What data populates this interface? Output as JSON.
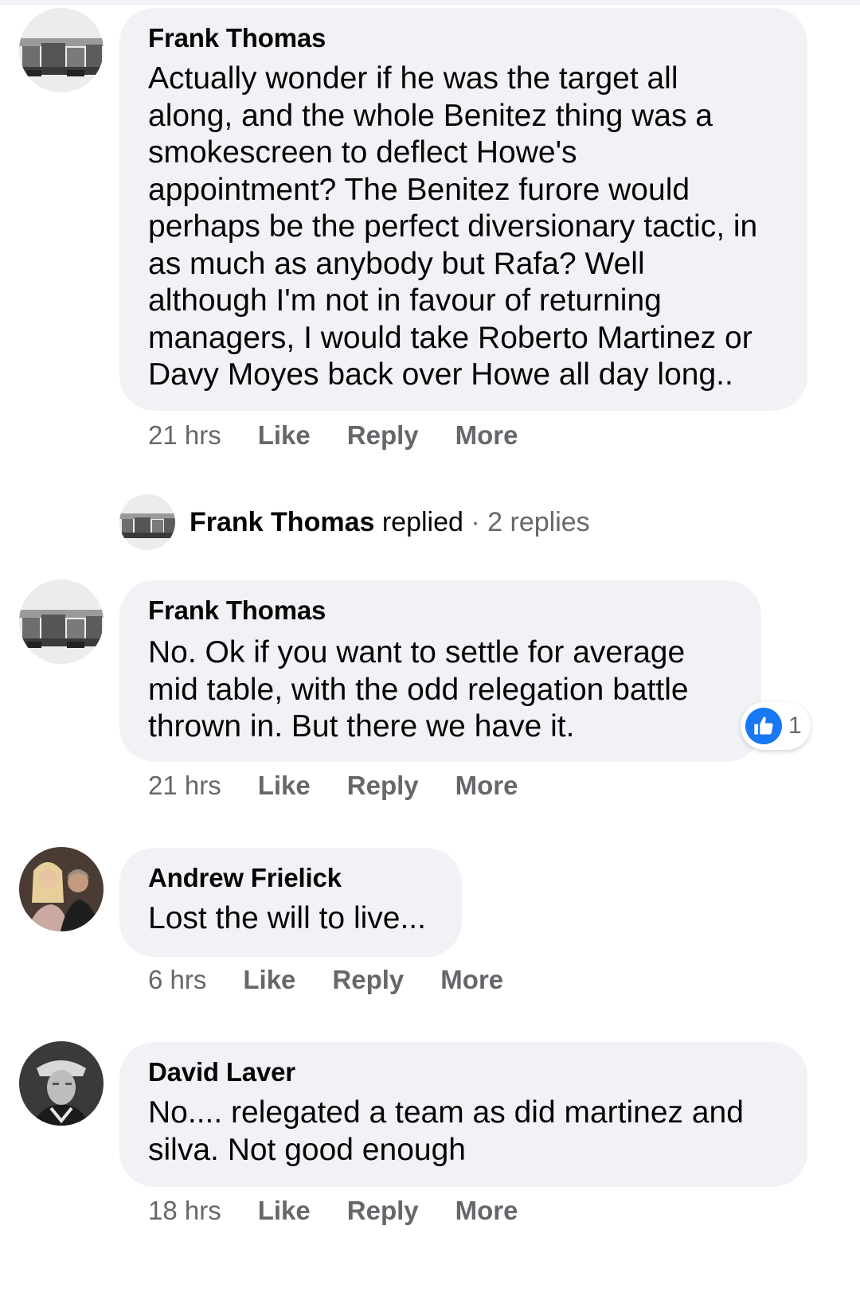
{
  "colors": {
    "bubble_bg": "#f0f2f5",
    "muted_text": "#65676b",
    "like_blue": "#1877f2"
  },
  "comments": [
    {
      "author": "Frank Thomas",
      "text": "Actually wonder if he was the target all\nalong, and the whole Benitez thing was a\nsmokescreen to deflect Howe's\nappointment? The Benitez furore would\nperhaps be the perfect diversionary tactic, in\nas much as anybody but Rafa? Well\nalthough I'm not in favour of returning\nmanagers, I would take Roberto Martinez or\nDavy Moyes back over Howe all day long..",
      "time": "21 hrs",
      "like": "Like",
      "reply": "Reply",
      "more": "More"
    },
    {
      "author": "Frank Thomas",
      "text": "No. Ok if you want to settle for average\nmid table, with the odd relegation battle\nthrown in. But there we have it.",
      "time": "21 hrs",
      "like": "Like",
      "reply": "Reply",
      "more": "More",
      "reaction_count": "1"
    },
    {
      "author": "Andrew Frielick",
      "text": "Lost the will to live...",
      "time": "6 hrs",
      "like": "Like",
      "reply": "Reply",
      "more": "More"
    },
    {
      "author": "David Laver",
      "text": "No.... relegated a team as did martinez and\nsilva. Not good enough",
      "time": "18 hrs",
      "like": "Like",
      "reply": "Reply",
      "more": "More"
    }
  ],
  "replied_row": {
    "name": "Frank Thomas",
    "verb": "replied",
    "separator": "·",
    "count": "2 replies"
  },
  "icons": {
    "like_reaction": "thumbs-up-icon"
  }
}
